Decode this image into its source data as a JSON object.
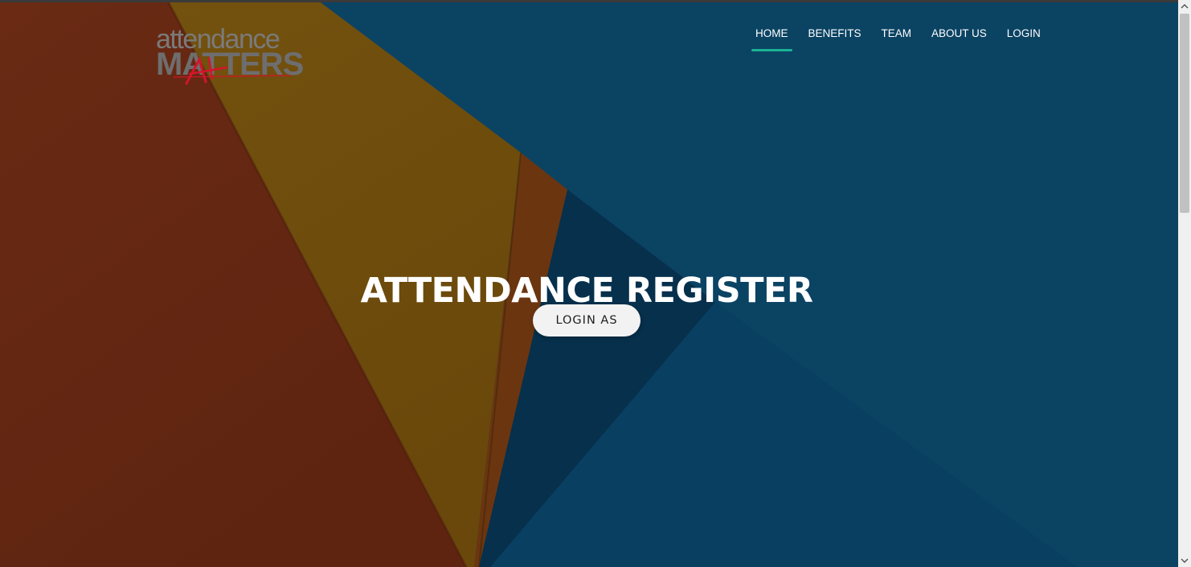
{
  "logo": {
    "line1": "attendance",
    "line2": "MATTERS"
  },
  "nav": {
    "items": [
      {
        "label": "HOME",
        "active": true
      },
      {
        "label": "BENEFITS",
        "active": false
      },
      {
        "label": "TEAM",
        "active": false
      },
      {
        "label": "ABOUT US",
        "active": false
      },
      {
        "label": "LOGIN",
        "active": false
      }
    ]
  },
  "hero": {
    "title": "ATTENDANCE REGISTER",
    "button_label": "LOGIN AS"
  },
  "colors": {
    "nav_active_underline": "#1ab394",
    "rust_panel": "#622411",
    "mustard_panel": "#6b4a0c",
    "navy_background": "#0a3a5a",
    "logo_accent": "#d4142a"
  },
  "icons": {
    "scroll_up": "chevron-up-icon",
    "scroll_down": "chevron-down-icon"
  }
}
